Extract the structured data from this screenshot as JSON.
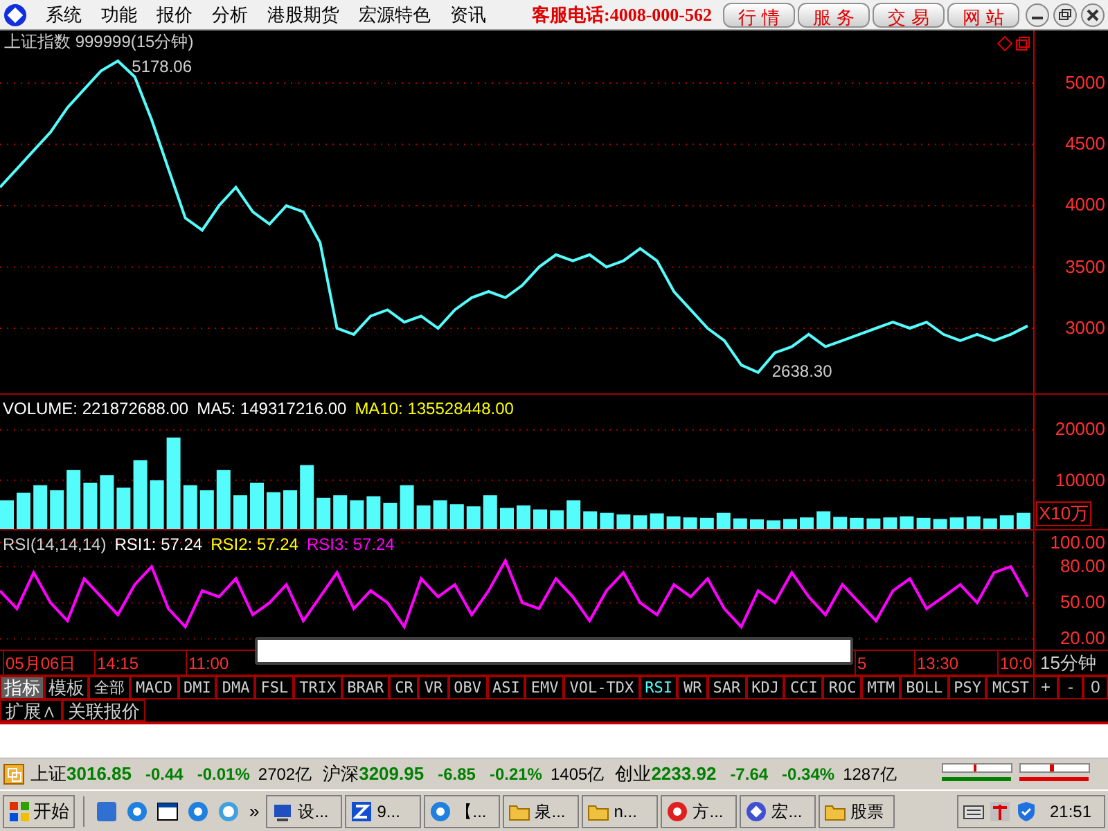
{
  "menu": {
    "items": [
      "系统",
      "功能",
      "报价",
      "分析",
      "港股期货",
      "宏源特色",
      "资讯"
    ]
  },
  "hotline": "客服电话:4008-000-562",
  "top_buttons": [
    "行 情",
    "服 务",
    "交 易",
    "网 站"
  ],
  "main_chart": {
    "title": "上证指数 999999(15分钟)",
    "chart_data": {
      "type": "line",
      "series": [
        {
          "color": "#54fcfc",
          "values": [
            4150,
            4300,
            4450,
            4600,
            4800,
            4950,
            5100,
            5180,
            5050,
            4700,
            4300,
            3900,
            3800,
            4000,
            4150,
            3950,
            3850,
            4000,
            3950,
            3700,
            3000,
            2950,
            3100,
            3150,
            3050,
            3100,
            3000,
            3150,
            3250,
            3300,
            3250,
            3350,
            3500,
            3600,
            3550,
            3600,
            3500,
            3550,
            3650,
            3550,
            3300,
            3150,
            3000,
            2900,
            2700,
            2640,
            2800,
            2850,
            2950,
            2850,
            2900,
            2950,
            3000,
            3050,
            3000,
            3050,
            2950,
            2900,
            2950,
            2900,
            2950,
            3020
          ]
        }
      ],
      "ylim": [
        2458,
        5429
      ],
      "grid": true,
      "yticks": [
        3000,
        3500,
        4000,
        4500,
        5000
      ],
      "annotations": [
        "5178.06",
        "2638.30"
      ]
    }
  },
  "volume_panel": {
    "legend": [
      {
        "text": "VOLUME: 221872688.00",
        "color": "#ffffff"
      },
      {
        "text": "MA5: 149317216.00",
        "color": "#ffffff"
      },
      {
        "text": "MA10: 135528448.00",
        "color": "#ffff00"
      }
    ],
    "unit_label": "X10万",
    "chart_data": {
      "type": "bar",
      "series": [
        {
          "color": "#54fcfc",
          "values": [
            6000,
            7500,
            9000,
            8000,
            12000,
            9500,
            11000,
            8500,
            14000,
            10000,
            18500,
            9000,
            8000,
            12000,
            7000,
            9500,
            7600,
            8000,
            13000,
            6500,
            7000,
            6000,
            6800,
            5500,
            9000,
            5000,
            6000,
            5200,
            4800,
            7000,
            4500,
            5000,
            4200,
            4000,
            6000,
            3800,
            3500,
            3200,
            3000,
            3400,
            2800,
            2600,
            2500,
            3500,
            2400,
            2200,
            2000,
            2300,
            2600,
            3800,
            2700,
            2500,
            2400,
            2600,
            2800,
            2500,
            2300,
            2600,
            2800,
            2400,
            3000,
            3500
          ]
        }
      ],
      "ylim": [
        0,
        27000
      ],
      "grid": true,
      "yticks": [
        10000,
        20000
      ]
    }
  },
  "rsi_panel": {
    "legend": [
      {
        "text": "RSI(14,14,14)",
        "color": "#d0d0d0"
      },
      {
        "text": "RSI1: 57.24",
        "color": "#ffffff"
      },
      {
        "text": "RSI2: 57.24",
        "color": "#ffff00"
      },
      {
        "text": "RSI3: 57.24",
        "color": "#ff00ff"
      }
    ],
    "chart_data": {
      "type": "line",
      "series": [
        {
          "color": "#ff00ff",
          "values": [
            60,
            45,
            75,
            50,
            35,
            70,
            55,
            40,
            65,
            80,
            45,
            30,
            60,
            55,
            70,
            40,
            50,
            65,
            35,
            55,
            75,
            45,
            60,
            50,
            30,
            70,
            55,
            65,
            40,
            60,
            85,
            50,
            45,
            70,
            55,
            35,
            60,
            75,
            50,
            40,
            65,
            55,
            70,
            45,
            30,
            60,
            50,
            75,
            55,
            40,
            65,
            50,
            35,
            60,
            70,
            45,
            55,
            65,
            50,
            75,
            80,
            55
          ]
        }
      ],
      "ylim": [
        10,
        110
      ],
      "grid": true,
      "yticks": [
        {
          "value": 20,
          "label": "20.00"
        },
        {
          "value": 50,
          "label": "50.00"
        },
        {
          "value": 80,
          "label": "80.00"
        },
        {
          "value": 100,
          "label": "100.00"
        }
      ]
    }
  },
  "time_axis": {
    "labels": [
      "05月06日",
      "14:15",
      "11:00",
      "5",
      "13:30",
      "10:0"
    ],
    "period": "15分钟"
  },
  "mode_tabs": [
    {
      "label": "指标",
      "selected": true
    },
    {
      "label": "模板",
      "selected": false
    }
  ],
  "indicator_tabs": [
    {
      "label": "全部",
      "selected": false
    },
    {
      "label": "MACD",
      "selected": false
    },
    {
      "label": "DMI",
      "selected": false
    },
    {
      "label": "DMA",
      "selected": false
    },
    {
      "label": "FSL",
      "selected": false
    },
    {
      "label": "TRIX",
      "selected": false
    },
    {
      "label": "BRAR",
      "selected": false
    },
    {
      "label": "CR",
      "selected": false
    },
    {
      "label": "VR",
      "selected": false
    },
    {
      "label": "OBV",
      "selected": false
    },
    {
      "label": "ASI",
      "selected": false
    },
    {
      "label": "EMV",
      "selected": false
    },
    {
      "label": "VOL-TDX",
      "selected": false
    },
    {
      "label": "RSI",
      "selected": true
    },
    {
      "label": "WR",
      "selected": false
    },
    {
      "label": "SAR",
      "selected": false
    },
    {
      "label": "KDJ",
      "selected": false
    },
    {
      "label": "CCI",
      "selected": false
    },
    {
      "label": "ROC",
      "selected": false
    },
    {
      "label": "MTM",
      "selected": false
    },
    {
      "label": "BOLL",
      "selected": false
    },
    {
      "label": "PSY",
      "selected": false
    },
    {
      "label": "MCST",
      "selected": false
    }
  ],
  "zoom_buttons": [
    "+",
    "-",
    "0"
  ],
  "extra_tabs": [
    "扩展∧",
    "关联报价"
  ],
  "status_bar": {
    "indices": [
      {
        "name": "上证",
        "price": "3016.85",
        "change": "-0.44",
        "percent": "-0.01%",
        "turnover": "2702亿"
      },
      {
        "name": "沪深",
        "price": "3209.95",
        "change": "-6.85",
        "percent": "-0.21%",
        "turnover": "1405亿"
      },
      {
        "name": "创业",
        "price": "2233.92",
        "change": "-7.64",
        "percent": "-0.34%",
        "turnover": "1287亿"
      }
    ]
  },
  "taskbar": {
    "start": "开始",
    "more": "»",
    "tasks": [
      "设...",
      "9...",
      "【...",
      "泉...",
      "n...",
      "方...",
      "宏...",
      "股票"
    ],
    "clock": "21:51"
  }
}
